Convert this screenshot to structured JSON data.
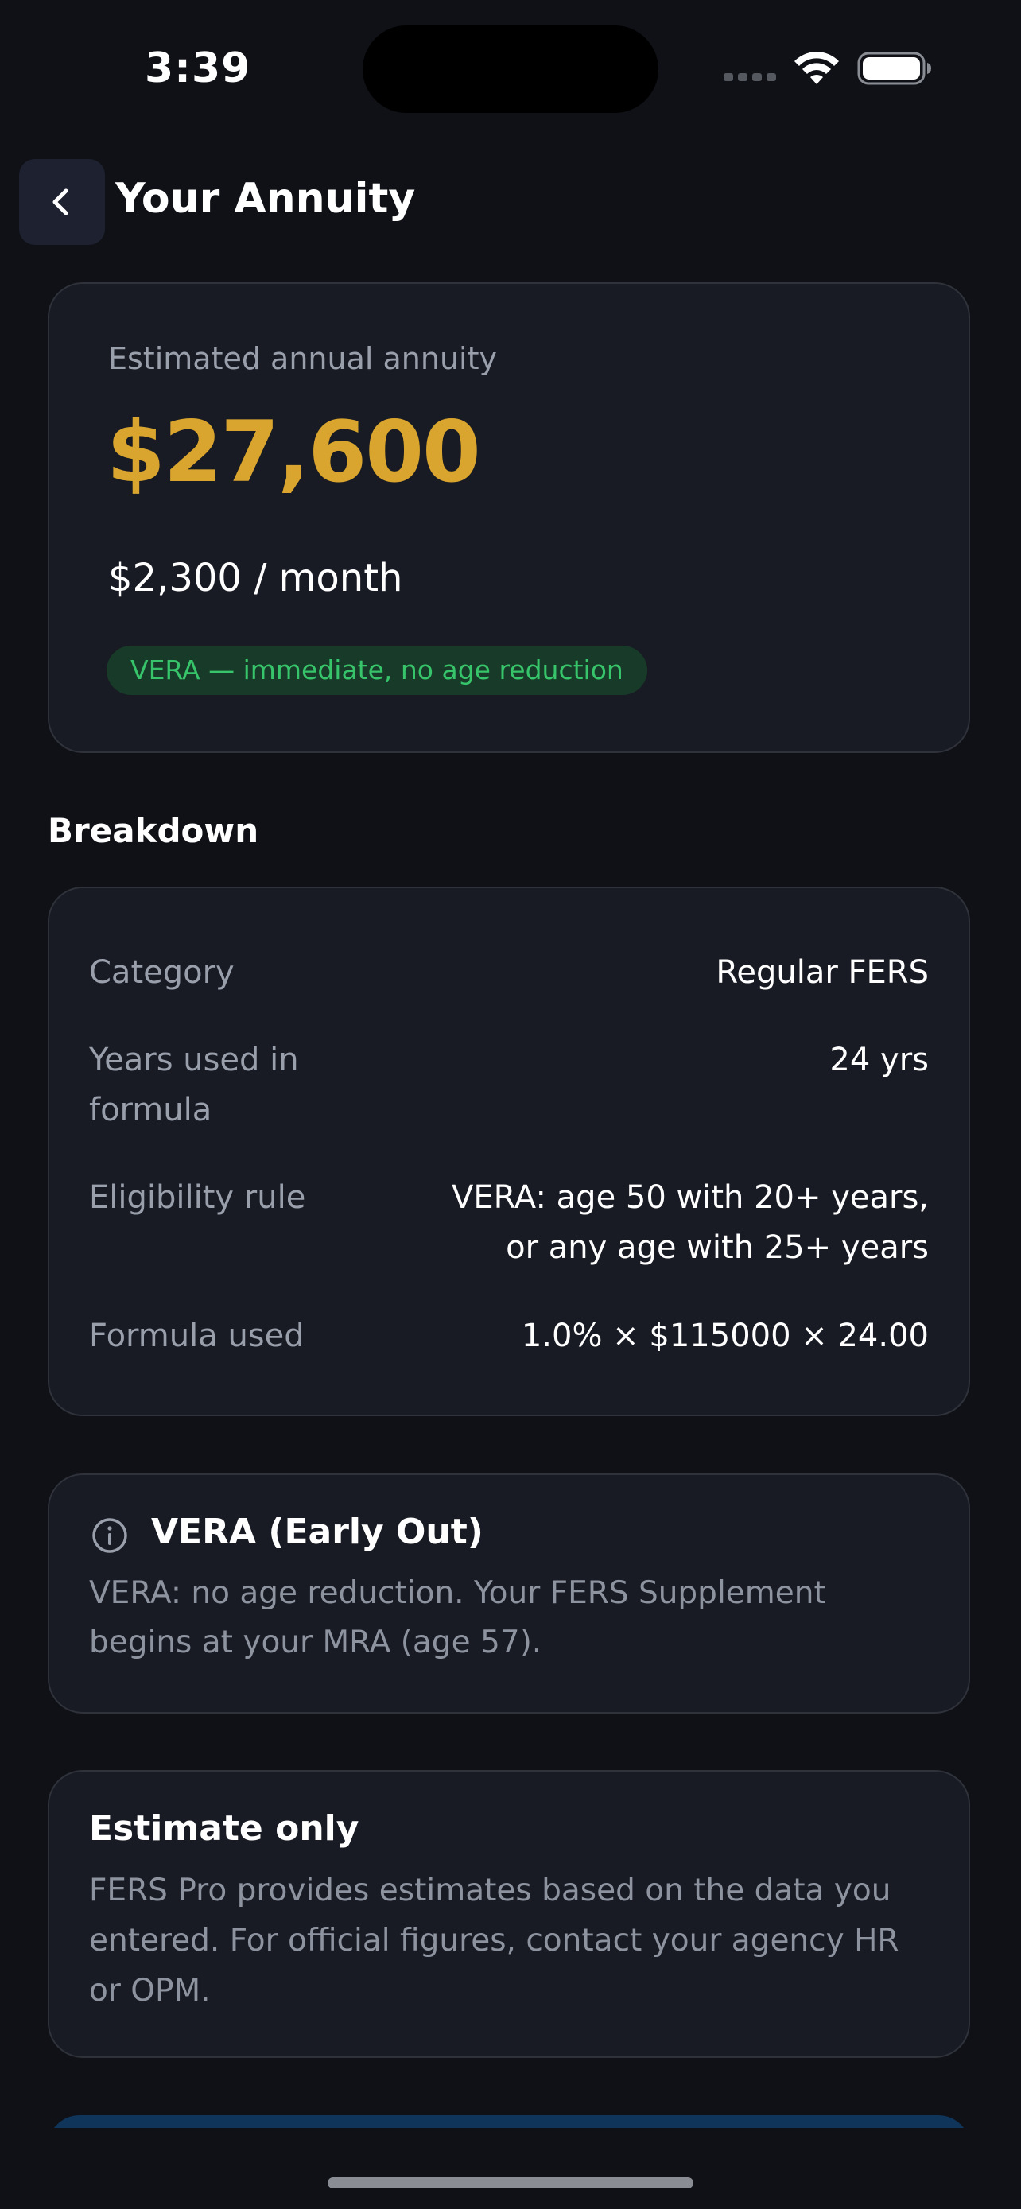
{
  "status_bar": {
    "time": "3:39"
  },
  "header": {
    "title": "Your Annuity",
    "back_icon": "chevron-left-icon"
  },
  "annuity": {
    "label": "Estimated annual annuity",
    "amount": "$27,600",
    "monthly": "$2,300 / month",
    "badge": "VERA — immediate, no age reduction"
  },
  "breakdown": {
    "title": "Breakdown",
    "rows": [
      {
        "label": "Category",
        "value": "Regular FERS"
      },
      {
        "label": "Years used in formula",
        "value": "24 yrs"
      },
      {
        "label": "Eligibility rule",
        "value": "VERA: age 50 with 20+ years, or any age with 25+ years"
      },
      {
        "label": "Formula used",
        "value": "1.0% × $115000 × 24.00"
      }
    ]
  },
  "vera_info": {
    "icon": "info-circle-icon",
    "title": "VERA (Early Out)",
    "body": "VERA: no age reduction. Your FERS Supplement begins at your MRA (age 57)."
  },
  "estimate_notice": {
    "title": "Estimate only",
    "body": "FERS Pro provides estimates based on the data you entered. For official figures, contact your agency HR or OPM."
  },
  "colors": {
    "background": "#0f1116",
    "card": "#181b23",
    "accent_gold": "#d9a52e",
    "badge_green": "#37c46a",
    "muted_text": "#9a9fac"
  }
}
